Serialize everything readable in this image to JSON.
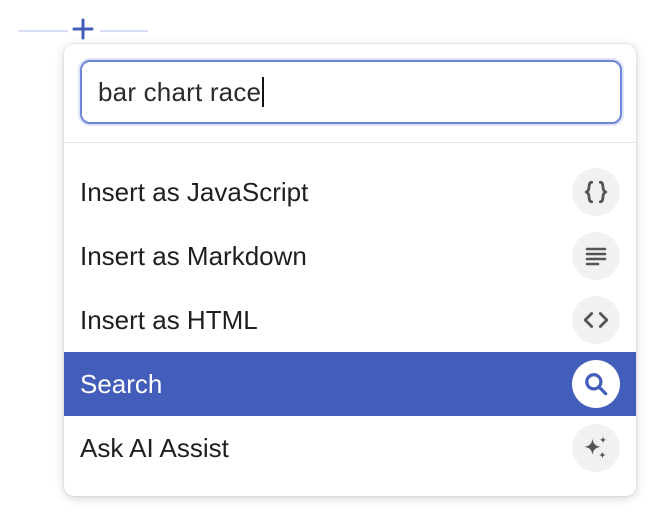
{
  "add_control": {
    "icon": "plus-icon",
    "color": "#435dba"
  },
  "search": {
    "value": "bar chart race"
  },
  "menu": {
    "items": [
      {
        "label": "Insert as JavaScript",
        "icon": "curly-braces-icon",
        "active": false
      },
      {
        "label": "Insert as Markdown",
        "icon": "text-lines-icon",
        "active": false
      },
      {
        "label": "Insert as HTML",
        "icon": "angle-brackets-icon",
        "active": false
      },
      {
        "label": "Search",
        "icon": "search-icon",
        "active": true
      },
      {
        "label": "Ask AI Assist",
        "icon": "sparkle-icon",
        "active": false
      }
    ]
  },
  "colors": {
    "accent": "#435dba",
    "focus_border": "#6f86d6",
    "icon_bg": "#f1f1f1"
  }
}
